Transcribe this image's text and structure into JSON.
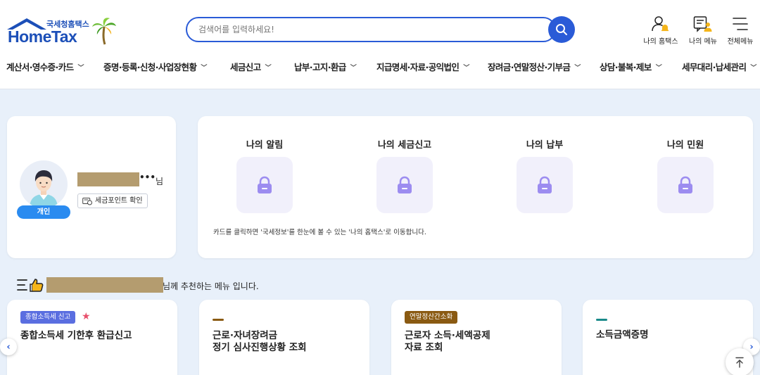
{
  "header": {
    "logo_sub": "국세청홈택스",
    "logo_main": "HomeTax",
    "search_placeholder": "검색어를 입력하세요!",
    "icons": [
      {
        "label": "나의 홈택스",
        "icon": "user-bell-icon"
      },
      {
        "label": "나의 메뉴",
        "icon": "menu-user-icon"
      },
      {
        "label": "전체메뉴",
        "icon": "hamburger-icon"
      }
    ]
  },
  "gnb": [
    "계산서·영수증·카드",
    "증명·등록·신청·사업장현황",
    "세금신고",
    "납부·고지·환급",
    "지급명세·자료·공익법인",
    "장려금·연말정산·기부금",
    "상담·불복·제보",
    "세무대리·납세관리"
  ],
  "profile": {
    "dots": "•••",
    "suffix": "님",
    "type_badge": "개인",
    "point_button": "세금포인트 확인"
  },
  "my": {
    "tiles": [
      "나의 알림",
      "나의 세금신고",
      "나의 납부",
      "나의 민원"
    ],
    "note": "카드를 클릭하면 '국세정보'를 한눈에 볼 수 있는 '나의 홈택스'로 이동합니다."
  },
  "recommend": {
    "text": "님께 추천하는 메뉴 입니다."
  },
  "cards": [
    {
      "tag": "종합소득세 신고",
      "tag_color": "#5a6ee0",
      "title": "종합소득세 기한후 환급신고",
      "star": "★"
    },
    {
      "tag": "",
      "dash_color": "#8a5a12",
      "title": "근로·자녀장려금\n정기 심사진행상황 조회"
    },
    {
      "tag": "연말정산간소화",
      "tag_color": "#8a5a12",
      "title": "근로자 소득·세액공제\n자료 조회"
    },
    {
      "tag": "",
      "dash_color": "#1a8a8a",
      "title": "소득금액증명"
    }
  ],
  "colors": {
    "brand": "#1c4fb8",
    "accent": "#2a5bd7",
    "background": "#e8f0fa",
    "lock": "#9c8cf0"
  }
}
